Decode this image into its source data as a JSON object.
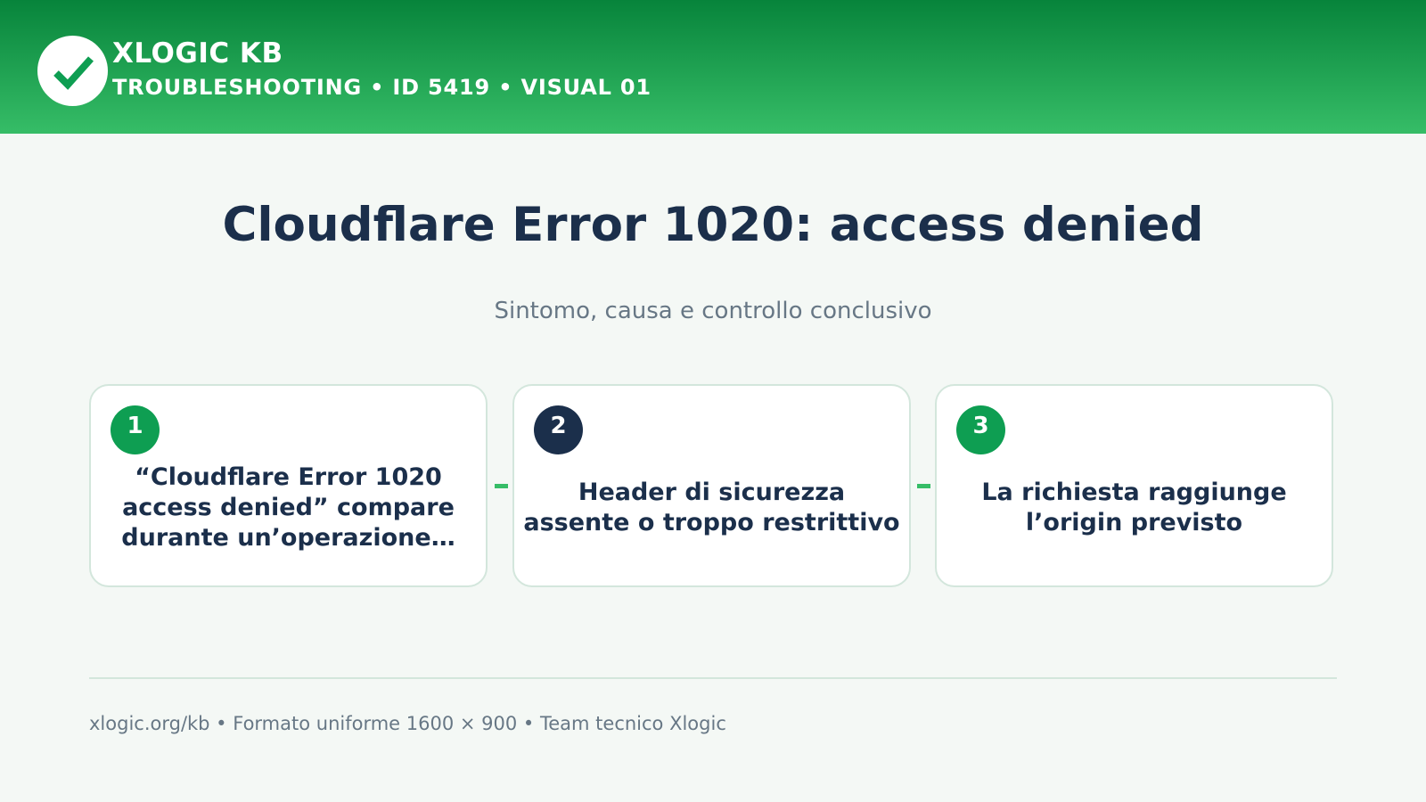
{
  "header": {
    "brand": "XLOGIC KB",
    "subtitle": "TROUBLESHOOTING • ID 5419 • VISUAL 01",
    "logo_icon": "checkmark-icon",
    "colors": {
      "gradient_top": "#07843b",
      "gradient_bottom": "#36bd67"
    }
  },
  "main": {
    "title": "Cloudflare Error 1020: access denied",
    "subtitle": "Sintomo, causa e controllo conclusivo",
    "steps": [
      {
        "number": "1",
        "text": "“Cloudflare Error 1020 access denied” compare durante un’operazione…",
        "badge_color": "#0e9e52"
      },
      {
        "number": "2",
        "text": "Header di sicurezza assente o troppo restrittivo",
        "badge_color": "#1b2f4b"
      },
      {
        "number": "3",
        "text": "La richiesta raggiunge l’origin previsto",
        "badge_color": "#0e9e52"
      }
    ]
  },
  "footer": {
    "text": "xlogic.org/kb • Formato uniforme 1600 × 900 • Team tecnico Xlogic"
  },
  "colors": {
    "accent": "#36bd67",
    "text_dark": "#1b2f4b",
    "text_muted": "#677785",
    "background": "#f4f8f5",
    "card_border": "#d3e6dc"
  }
}
